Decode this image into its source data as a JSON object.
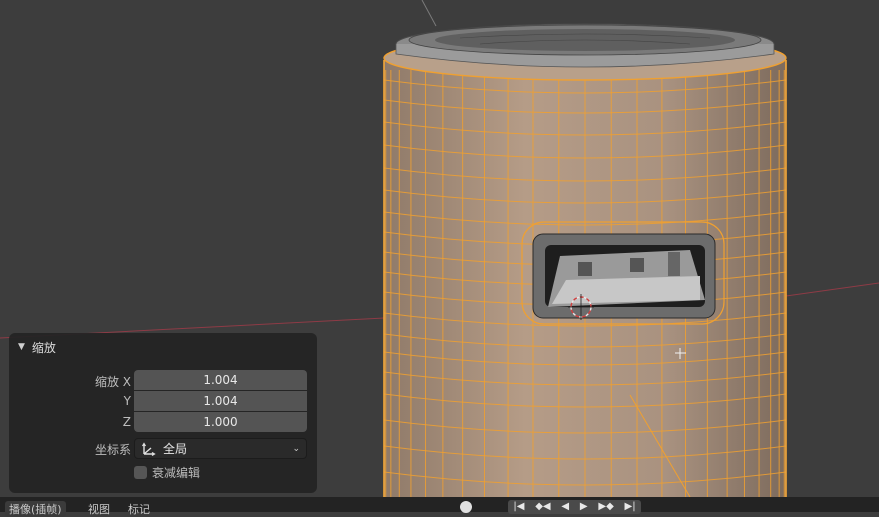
{
  "viewport": {
    "name": "3D Viewport"
  },
  "operator_panel": {
    "title": "缩放",
    "scale_x_label": "缩放 X",
    "scale_y_label": "Y",
    "scale_z_label": "Z",
    "scale_x": "1.004",
    "scale_y": "1.004",
    "scale_z": "1.000",
    "orientation_label": "坐标系",
    "orientation_value": "全局",
    "proportional_label": "衰减编辑"
  },
  "bottom_bar": {
    "menu_playback": "播像(插帧)",
    "menu_view": "视图",
    "menu_marker": "标记",
    "transport_icons": [
      "jump-start-icon",
      "prev-keyframe-icon",
      "play-reverse-icon",
      "play-icon",
      "next-keyframe-icon",
      "jump-end-icon"
    ]
  },
  "colors": {
    "background": "#3d3d3d",
    "selection_wire": "#f0a030",
    "mesh_face": "#a58c78",
    "panel": "#242424"
  }
}
